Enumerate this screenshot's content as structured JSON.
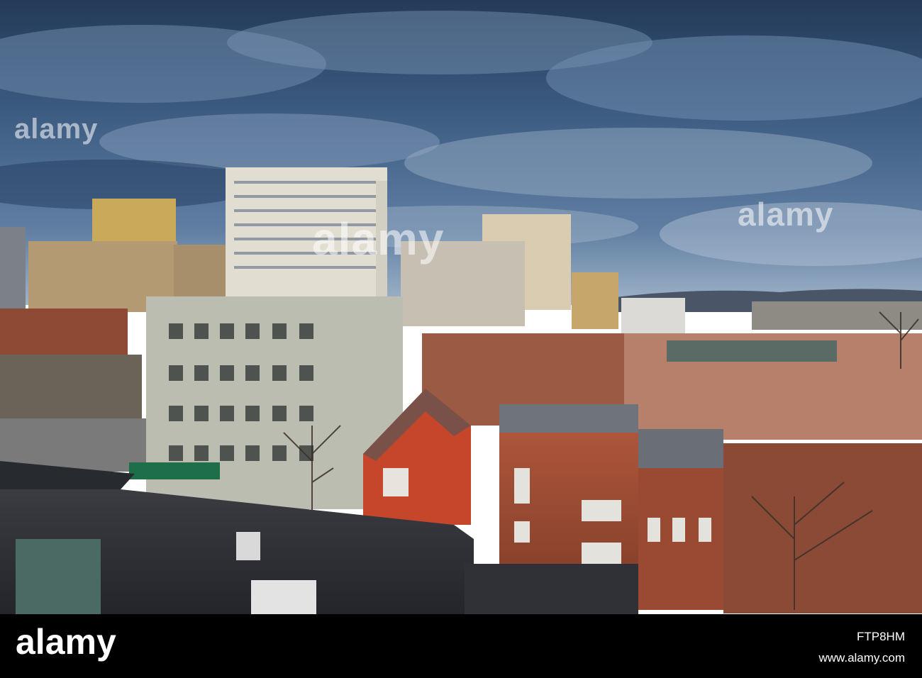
{
  "watermark": {
    "brand": "alamy"
  },
  "footer": {
    "logo": "alamy",
    "image_id": "FTP8HM",
    "url": "www.alamy.com"
  },
  "colors": {
    "sky_dark": "#2f4b6e",
    "sky_light": "#8aa2bd",
    "brick": "#a2533a",
    "brick_bright": "#c8472a",
    "concrete": "#bfc0b4",
    "roof_dark": "#2e2f33",
    "footer_bg": "#000000"
  }
}
